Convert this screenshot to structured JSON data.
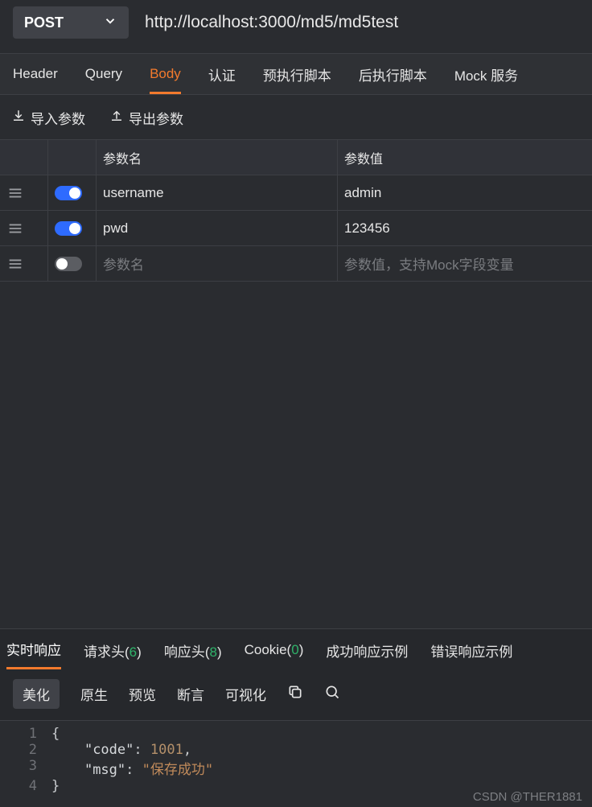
{
  "request": {
    "method": "POST",
    "url": "http://localhost:3000/md5/md5test"
  },
  "tabs": {
    "header": "Header",
    "query": "Query",
    "body": "Body",
    "auth": "认证",
    "prescript": "预执行脚本",
    "postscript": "后执行脚本",
    "mock": "Mock 服务",
    "active": "body"
  },
  "io": {
    "import_label": "导入参数",
    "export_label": "导出参数"
  },
  "param_table": {
    "header_name": "参数名",
    "header_value": "参数值",
    "rows": [
      {
        "enabled": true,
        "name": "username",
        "value": "admin"
      },
      {
        "enabled": true,
        "name": "pwd",
        "value": "123456"
      }
    ],
    "placeholder_name": "参数名",
    "placeholder_value": "参数值，支持Mock字段变量"
  },
  "response": {
    "tabs": {
      "realtime": "实时响应",
      "reqheaders_label": "请求头",
      "reqheaders_count": "6",
      "resheaders_label": "响应头",
      "resheaders_count": "8",
      "cookie_label": "Cookie",
      "cookie_count": "0",
      "success_example": "成功响应示例",
      "error_example": "错误响应示例"
    },
    "tools": {
      "beautify": "美化",
      "raw": "原生",
      "preview": "预览",
      "assert": "断言",
      "visualize": "可视化"
    },
    "body_lines": [
      "{",
      "    \"code\": 1001,",
      "    \"msg\": \"保存成功\"",
      "}"
    ],
    "body_json": {
      "code": 1001,
      "msg": "保存成功"
    }
  },
  "watermark": "CSDN @THER1881"
}
